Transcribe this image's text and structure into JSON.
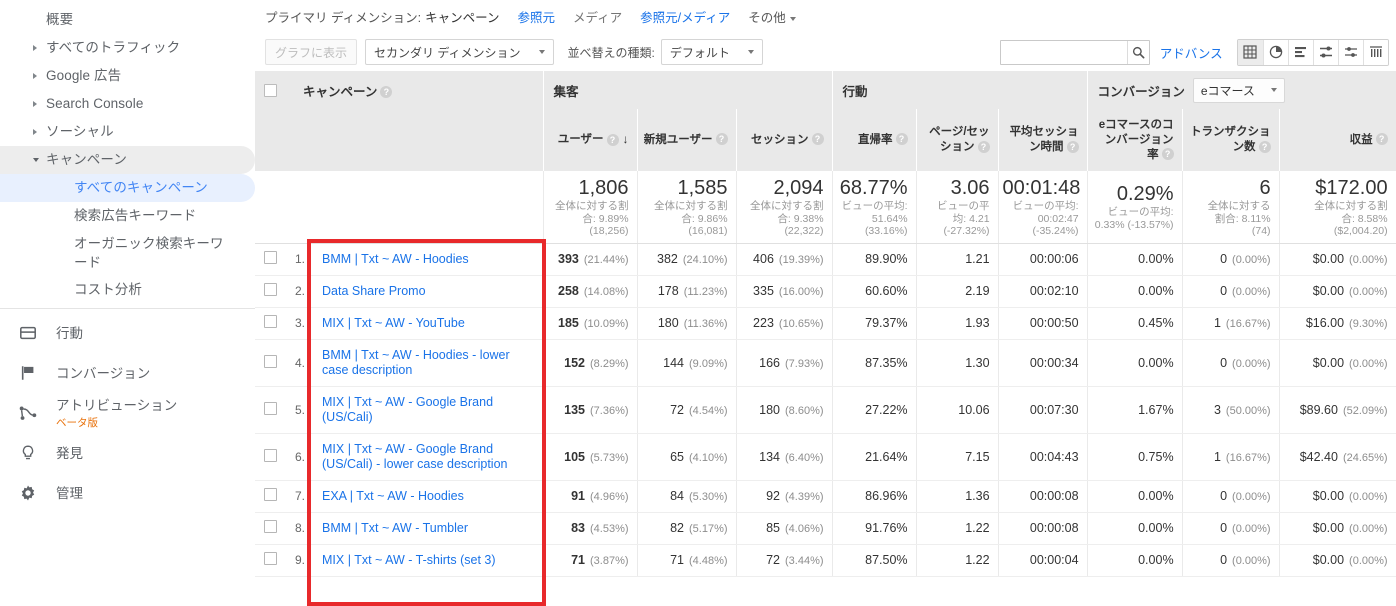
{
  "sidebar": {
    "items": [
      {
        "label": "概要",
        "level": 1,
        "caret": "none",
        "selected": false
      },
      {
        "label": "すべてのトラフィック",
        "level": 1,
        "caret": "right",
        "selected": false
      },
      {
        "label": "Google 広告",
        "level": 1,
        "caret": "right",
        "selected": false
      },
      {
        "label": "Search Console",
        "level": 1,
        "caret": "right",
        "selected": false
      },
      {
        "label": "ソーシャル",
        "level": 1,
        "caret": "right",
        "selected": false
      },
      {
        "label": "キャンペーン",
        "level": 1,
        "caret": "down",
        "selected": false,
        "expanded": true
      },
      {
        "label": "すべてのキャンペーン",
        "level": 2,
        "caret": "none",
        "selected": true
      },
      {
        "label": "検索広告キーワード",
        "level": 2,
        "caret": "none",
        "selected": false
      },
      {
        "label": "オーガニック検索キーワード",
        "level": 2,
        "caret": "none",
        "selected": false
      },
      {
        "label": "コスト分析",
        "level": 2,
        "caret": "none",
        "selected": false
      }
    ],
    "top_items": [
      {
        "label": "行動",
        "icon": "behavior-icon",
        "beta": ""
      },
      {
        "label": "コンバージョン",
        "icon": "flag-icon",
        "beta": ""
      },
      {
        "label": "アトリビューション",
        "icon": "attribution-icon",
        "beta": "ベータ版"
      },
      {
        "label": "発見",
        "icon": "bulb-icon",
        "beta": ""
      },
      {
        "label": "管理",
        "icon": "gear-icon",
        "beta": ""
      }
    ]
  },
  "dimension_bar": {
    "label": "プライマリ ディメンション:",
    "current": "キャンペーン",
    "links": [
      "参照元",
      "メディア",
      "参照元/メディア"
    ],
    "other": "その他"
  },
  "controls": {
    "plot_rows": "グラフに表示",
    "secondary_dimension": "セカンダリ ディメンション",
    "sort_type_label": "並べ替えの種類:",
    "sort_type_value": "デフォルト",
    "search_value": "",
    "search_placeholder": "",
    "advanced": "アドバンス",
    "view_buttons": [
      "table-view-icon",
      "pie-chart-icon",
      "bar-chart-icon",
      "comparison-icon",
      "pivot-icon",
      "performance-icon"
    ]
  },
  "table": {
    "group_headers": [
      {
        "label": "集客"
      },
      {
        "label": "行動"
      },
      {
        "label": "コンバージョン",
        "dropdown": "eコマース"
      }
    ],
    "dimension_header": "キャンペーン",
    "columns": [
      "ユーザー",
      "新規ユーザー",
      "セッション",
      "直帰率",
      "ページ/セッション",
      "平均セッション時間",
      "eコマースのコンバージョン率",
      "トランザクション数",
      "収益"
    ],
    "sorted_column": "ユーザー",
    "sort_direction": "desc",
    "summary": [
      {
        "value": "1,806",
        "sub1": "全体に対する割",
        "sub2": "合: 9.89%",
        "sub3": "(18,256)"
      },
      {
        "value": "1,585",
        "sub1": "全体に対する割",
        "sub2": "合: 9.86%",
        "sub3": "(16,081)"
      },
      {
        "value": "2,094",
        "sub1": "全体に対する割",
        "sub2": "合: 9.38%",
        "sub3": "(22,322)"
      },
      {
        "value": "68.77%",
        "sub1": "ビューの平均:",
        "sub2": "51.64%",
        "sub3": "(33.16%)"
      },
      {
        "value": "3.06",
        "sub1": "ビューの平",
        "sub2": "均: 4.21",
        "sub3": "(-27.32%)"
      },
      {
        "value": "00:01:48",
        "sub1": "ビューの平均:",
        "sub2": "00:02:47",
        "sub3": "(-35.24%)"
      },
      {
        "value": "0.29%",
        "sub1": "ビューの平均:",
        "sub2": "0.33% (-13.57%)",
        "sub3": ""
      },
      {
        "value": "6",
        "sub1": "全体に対する",
        "sub2": "割合: 8.11%",
        "sub3": "(74)"
      },
      {
        "value": "$172.00",
        "sub1": "全体に対する割",
        "sub2": "合: 8.58%",
        "sub3": "($2,004.20)"
      }
    ],
    "rows": [
      {
        "n": "1.",
        "name": "BMM | Txt ~ AW - Hoodies",
        "users": "393",
        "users_pct": "(21.44%)",
        "new_users": "382",
        "new_users_pct": "(24.10%)",
        "sessions": "406",
        "sessions_pct": "(19.39%)",
        "bounce": "89.90%",
        "pages": "1.21",
        "duration": "00:00:06",
        "conv": "0.00%",
        "trans": "0",
        "trans_pct": "(0.00%)",
        "revenue": "$0.00",
        "revenue_pct": "(0.00%)"
      },
      {
        "n": "2.",
        "name": "Data Share Promo",
        "users": "258",
        "users_pct": "(14.08%)",
        "new_users": "178",
        "new_users_pct": "(11.23%)",
        "sessions": "335",
        "sessions_pct": "(16.00%)",
        "bounce": "60.60%",
        "pages": "2.19",
        "duration": "00:02:10",
        "conv": "0.00%",
        "trans": "0",
        "trans_pct": "(0.00%)",
        "revenue": "$0.00",
        "revenue_pct": "(0.00%)"
      },
      {
        "n": "3.",
        "name": "MIX | Txt ~ AW - YouTube",
        "users": "185",
        "users_pct": "(10.09%)",
        "new_users": "180",
        "new_users_pct": "(11.36%)",
        "sessions": "223",
        "sessions_pct": "(10.65%)",
        "bounce": "79.37%",
        "pages": "1.93",
        "duration": "00:00:50",
        "conv": "0.45%",
        "trans": "1",
        "trans_pct": "(16.67%)",
        "revenue": "$16.00",
        "revenue_pct": "(9.30%)"
      },
      {
        "n": "4.",
        "name": "BMM | Txt ~ AW - Hoodies - lower case description",
        "users": "152",
        "users_pct": "(8.29%)",
        "new_users": "144",
        "new_users_pct": "(9.09%)",
        "sessions": "166",
        "sessions_pct": "(7.93%)",
        "bounce": "87.35%",
        "pages": "1.30",
        "duration": "00:00:34",
        "conv": "0.00%",
        "trans": "0",
        "trans_pct": "(0.00%)",
        "revenue": "$0.00",
        "revenue_pct": "(0.00%)"
      },
      {
        "n": "5.",
        "name": "MIX | Txt ~ AW - Google Brand (US/Cali)",
        "users": "135",
        "users_pct": "(7.36%)",
        "new_users": "72",
        "new_users_pct": "(4.54%)",
        "sessions": "180",
        "sessions_pct": "(8.60%)",
        "bounce": "27.22%",
        "pages": "10.06",
        "duration": "00:07:30",
        "conv": "1.67%",
        "trans": "3",
        "trans_pct": "(50.00%)",
        "revenue": "$89.60",
        "revenue_pct": "(52.09%)"
      },
      {
        "n": "6.",
        "name": "MIX | Txt ~ AW - Google Brand (US/Cali) - lower case description",
        "users": "105",
        "users_pct": "(5.73%)",
        "new_users": "65",
        "new_users_pct": "(4.10%)",
        "sessions": "134",
        "sessions_pct": "(6.40%)",
        "bounce": "21.64%",
        "pages": "7.15",
        "duration": "00:04:43",
        "conv": "0.75%",
        "trans": "1",
        "trans_pct": "(16.67%)",
        "revenue": "$42.40",
        "revenue_pct": "(24.65%)"
      },
      {
        "n": "7.",
        "name": "EXA | Txt ~ AW - Hoodies",
        "users": "91",
        "users_pct": "(4.96%)",
        "new_users": "84",
        "new_users_pct": "(5.30%)",
        "sessions": "92",
        "sessions_pct": "(4.39%)",
        "bounce": "86.96%",
        "pages": "1.36",
        "duration": "00:00:08",
        "conv": "0.00%",
        "trans": "0",
        "trans_pct": "(0.00%)",
        "revenue": "$0.00",
        "revenue_pct": "(0.00%)"
      },
      {
        "n": "8.",
        "name": "BMM | Txt ~ AW - Tumbler",
        "users": "83",
        "users_pct": "(4.53%)",
        "new_users": "82",
        "new_users_pct": "(5.17%)",
        "sessions": "85",
        "sessions_pct": "(4.06%)",
        "bounce": "91.76%",
        "pages": "1.22",
        "duration": "00:00:08",
        "conv": "0.00%",
        "trans": "0",
        "trans_pct": "(0.00%)",
        "revenue": "$0.00",
        "revenue_pct": "(0.00%)"
      },
      {
        "n": "9.",
        "name": "MIX | Txt ~ AW - T-shirts (set 3)",
        "users": "71",
        "users_pct": "(3.87%)",
        "new_users": "71",
        "new_users_pct": "(4.48%)",
        "sessions": "72",
        "sessions_pct": "(3.44%)",
        "bounce": "87.50%",
        "pages": "1.22",
        "duration": "00:00:04",
        "conv": "0.00%",
        "trans": "0",
        "trans_pct": "(0.00%)",
        "revenue": "$0.00",
        "revenue_pct": "(0.00%)"
      }
    ]
  },
  "annotation": {
    "color": "#e8292b"
  }
}
